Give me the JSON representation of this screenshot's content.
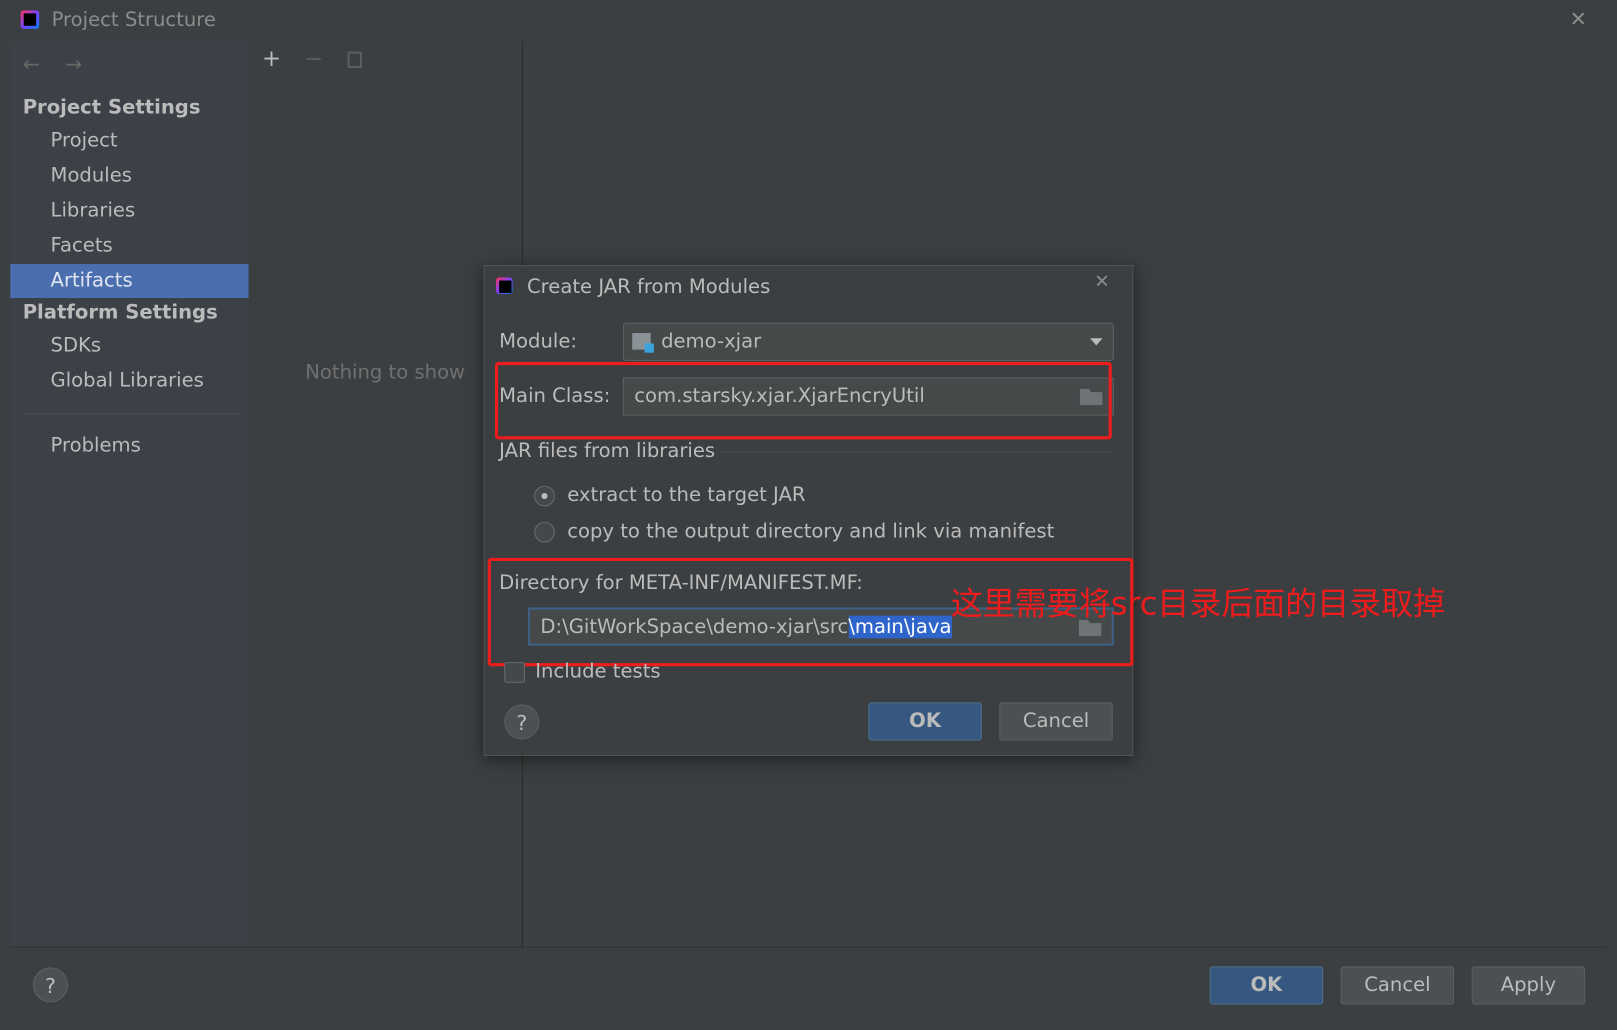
{
  "window": {
    "title": "Project Structure"
  },
  "sidebar": {
    "sections": [
      {
        "label": "Project Settings",
        "items": [
          "Project",
          "Modules",
          "Libraries",
          "Facets",
          "Artifacts"
        ]
      },
      {
        "label": "Platform Settings",
        "items": [
          "SDKs",
          "Global Libraries"
        ]
      }
    ],
    "problems": "Problems",
    "selected": "Artifacts"
  },
  "middle": {
    "empty_text": "Nothing to show"
  },
  "footer": {
    "ok": "OK",
    "cancel": "Cancel",
    "apply": "Apply",
    "help": "?"
  },
  "dialog": {
    "title": "Create JAR from Modules",
    "module_label": "Module:",
    "module_value": "demo-xjar",
    "main_class_label": "Main Class:",
    "main_class_value": "com.starsky.xjar.XjarEncryUtil",
    "jar_files_label": "JAR files from libraries",
    "radio_extract": "extract to the target JAR",
    "radio_copy": "copy to the output directory and link via manifest",
    "radio_selected": "extract to the target JAR",
    "manifest_label": "Directory for META-INF/MANIFEST.MF:",
    "manifest_value_plain": "D:\\GitWorkSpace\\demo-xjar\\src",
    "manifest_value_selected": "\\main\\java",
    "include_tests": "Include tests",
    "include_tests_checked": false,
    "ok": "OK",
    "cancel": "Cancel",
    "help": "?"
  },
  "annotation": {
    "text": "这里需要将src目录后面的目录取掉",
    "color": "#ee1c1c"
  },
  "colors": {
    "selection": "#4b6eaf",
    "primary_button": "#365880",
    "highlight_box": "#ee1c1c"
  }
}
